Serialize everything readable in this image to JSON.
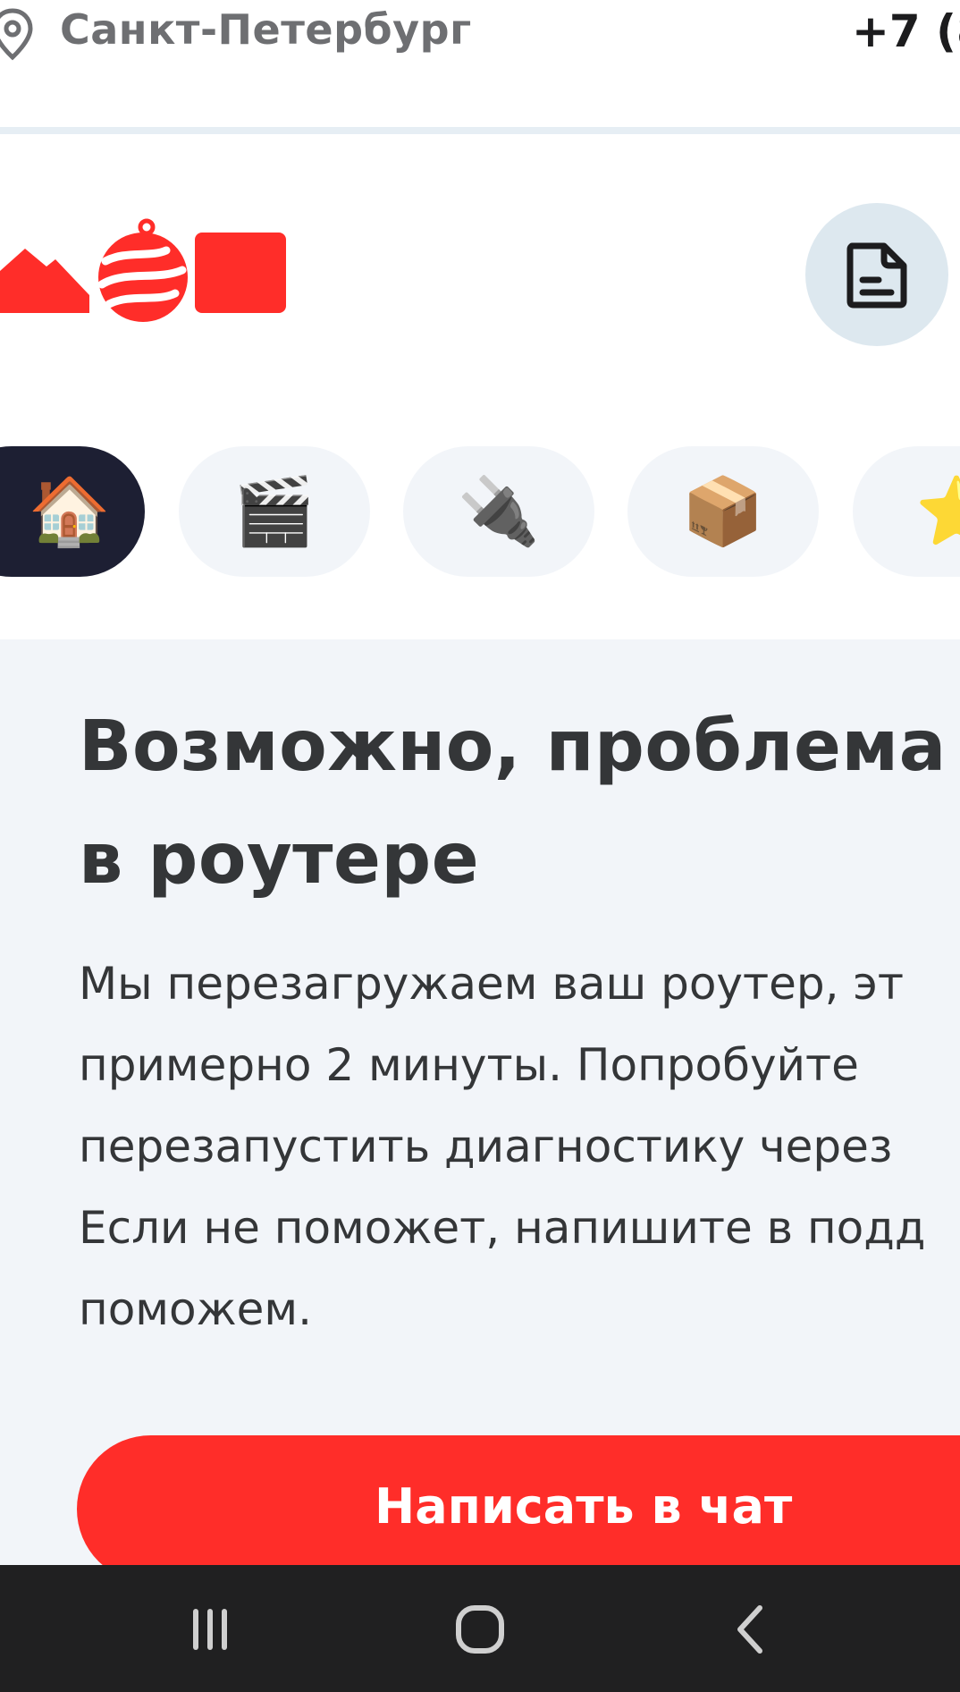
{
  "topbar": {
    "icon": "location-pin-icon",
    "city": "Санкт-Петербург",
    "phone": "+7 (8"
  },
  "header": {
    "logo": "brand-logo",
    "doc_icon": "document-icon"
  },
  "categories": [
    {
      "icon": "house-icon",
      "glyph": "🏠",
      "active": true
    },
    {
      "icon": "clapper-icon",
      "glyph": "🎬",
      "active": false
    },
    {
      "icon": "plug-icon",
      "glyph": "🔌",
      "active": false
    },
    {
      "icon": "package-icon",
      "glyph": "📦",
      "active": false
    },
    {
      "icon": "star-icon",
      "glyph": "⭐",
      "active": false
    }
  ],
  "main": {
    "title_lines": [
      "Возможно, проблема",
      "в роутере"
    ],
    "description_lines": [
      "Мы перезагружаем ваш роутер, эт",
      "примерно 2 минуты. Попробуйте",
      "перезапустить диагностику через",
      "Если не поможет, напишите в подд",
      "поможем."
    ],
    "chat_button_label": "Написать в чат"
  },
  "colors": {
    "brand_red": "#ff2d29",
    "active_pill": "#1d1f33",
    "content_bg": "#f2f5f9",
    "navbar_bg": "#202021"
  },
  "navbar": {
    "recent_icon": "recent-apps-icon",
    "home_icon": "home-icon",
    "back_icon": "back-icon"
  }
}
